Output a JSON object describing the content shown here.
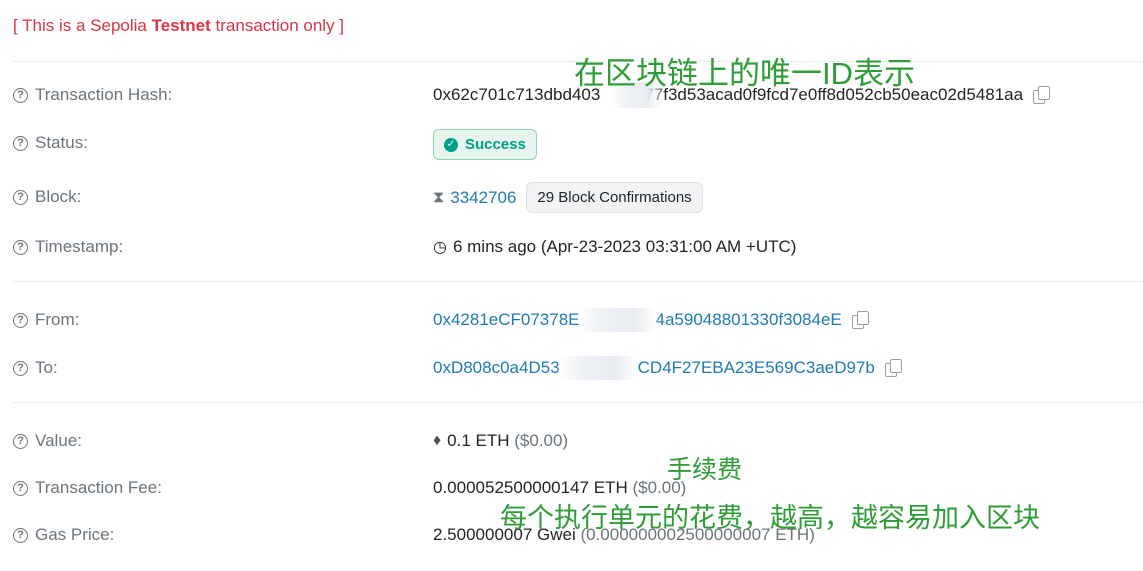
{
  "notice": {
    "prefix": "[ This is a Sepolia ",
    "bold": "Testnet",
    "suffix": " transaction only ]"
  },
  "rows": {
    "tx_hash": {
      "label": "Transaction Hash:",
      "value_start": "0x62c701c713dbd403",
      "value_end": "77f3d53acad0f9fcd7e0ff8d052cb50eac02d5481aa"
    },
    "status": {
      "label": "Status:",
      "badge": "Success"
    },
    "block": {
      "label": "Block:",
      "number": "3342706",
      "confirmations": "29 Block Confirmations"
    },
    "timestamp": {
      "label": "Timestamp:",
      "value": "6 mins ago (Apr-23-2023 03:31:00 AM +UTC)"
    },
    "from": {
      "label": "From:",
      "value_start": "0x4281eCF07378E",
      "value_end": "4a59048801330f3084eE"
    },
    "to": {
      "label": "To:",
      "value_start": "0xD808c0a4D53",
      "value_end": "CD4F27EBA23E569C3aeD97b"
    },
    "value": {
      "label": "Value:",
      "amount": "0.1 ETH",
      "fiat": "($0.00)"
    },
    "fee": {
      "label": "Transaction Fee:",
      "amount": "0.000052500000147 ETH",
      "fiat": "($0.00)"
    },
    "gas_price": {
      "label": "Gas Price:",
      "amount": "2.500000007 Gwei",
      "eth": "(0.000000002500000007 ETH)"
    }
  },
  "annotations": {
    "hash_note": "在区块链上的唯一ID表示",
    "fee_note": "手续费",
    "gas_note": "每个执行单元的花费，越高，越容易加入区块"
  },
  "colors": {
    "link": "#1f7ab8",
    "success": "#00a186",
    "notice": "#dc3545",
    "annotation": "#2e9d36"
  },
  "icons": [
    "question-circle-icon",
    "copy-icon",
    "check-circle-icon",
    "hourglass-icon",
    "clock-icon",
    "ethereum-icon"
  ]
}
